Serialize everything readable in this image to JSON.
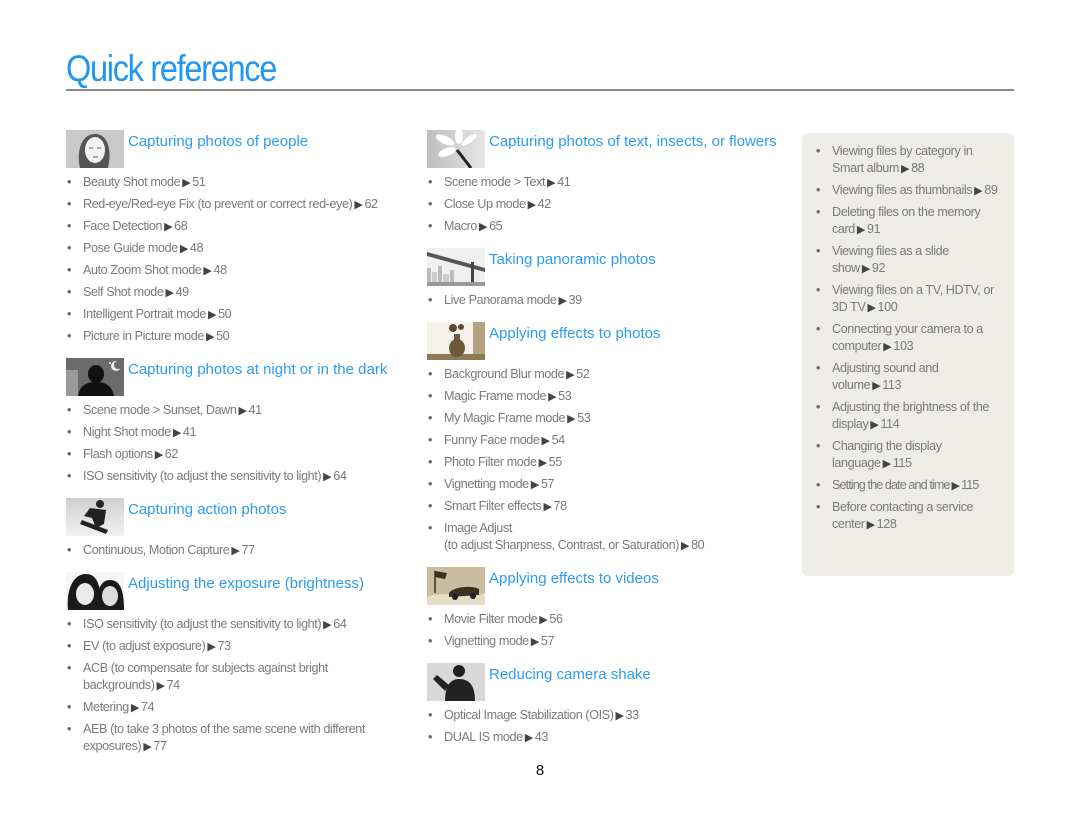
{
  "page": {
    "title": "Quick reference",
    "page_number": "8",
    "arrow_glyph": "▶"
  },
  "colors": {
    "heading": "#2196f3",
    "section_title": "#2b9cf0",
    "body_text": "#7a7a7a",
    "panel_bg": "#eeece6"
  },
  "column1": [
    {
      "title": "Capturing photos of people",
      "icon": "portrait-woman-icon",
      "items": [
        {
          "text": "Beauty Shot mode",
          "page": "51"
        },
        {
          "text": "Red-eye/Red-eye Fix (to prevent or correct red-eye)",
          "page": "62"
        },
        {
          "text": "Face Detection",
          "page": "68"
        },
        {
          "text": "Pose Guide mode",
          "page": "48"
        },
        {
          "text": "Auto Zoom Shot mode",
          "page": "48"
        },
        {
          "text": "Self Shot mode",
          "page": "49"
        },
        {
          "text": "Intelligent Portrait mode",
          "page": "50"
        },
        {
          "text": "Picture in Picture mode",
          "page": "50"
        }
      ]
    },
    {
      "title": "Capturing photos at night or in the dark",
      "icon": "night-silhouette-icon",
      "items": [
        {
          "text": "Scene mode > Sunset, Dawn",
          "page": "41"
        },
        {
          "text": "Night Shot mode",
          "page": "41"
        },
        {
          "text": "Flash options",
          "page": "62"
        },
        {
          "text": "ISO sensitivity (to adjust the sensitivity to light)",
          "page": "64"
        }
      ]
    },
    {
      "title": "Capturing action photos",
      "icon": "snowboarder-icon",
      "items": [
        {
          "text": "Continuous, Motion Capture",
          "page": "77"
        }
      ]
    },
    {
      "title": "Adjusting the exposure (brightness)",
      "icon": "couple-faces-icon",
      "items": [
        {
          "text": "ISO sensitivity (to adjust the sensitivity to light)",
          "page": "64"
        },
        {
          "text": "EV (to adjust exposure)",
          "page": "73"
        },
        {
          "text": "ACB (to compensate for subjects against bright backgrounds)",
          "page": "74"
        },
        {
          "text": "Metering",
          "page": "74"
        },
        {
          "text": "AEB (to take 3 photos of the same scene with different exposures)",
          "page": "77"
        }
      ]
    }
  ],
  "column2": [
    {
      "title": "Capturing  photos of text, insects, or flowers",
      "icon": "flower-macro-icon",
      "items": [
        {
          "text": "Scene mode > Text",
          "page": "41"
        },
        {
          "text": "Close Up mode",
          "page": "42"
        },
        {
          "text": "Macro",
          "page": "65"
        }
      ]
    },
    {
      "title": "Taking panoramic photos",
      "icon": "bridge-panorama-icon",
      "items": [
        {
          "text": "Live Panorama mode",
          "page": "39"
        }
      ]
    },
    {
      "title": "Applying effects to photos",
      "icon": "vase-still-life-icon",
      "items": [
        {
          "text": "Background Blur mode",
          "page": "52"
        },
        {
          "text": "Magic Frame mode",
          "page": "53"
        },
        {
          "text": "My Magic Frame mode",
          "page": "53"
        },
        {
          "text": "Funny Face mode",
          "page": "54"
        },
        {
          "text": "Photo Filter mode",
          "page": "55"
        },
        {
          "text": "Vignetting mode",
          "page": "57"
        },
        {
          "text": "Smart Filter effects",
          "page": "78"
        },
        {
          "text": "Image Adjust\n(to adjust Sharpness, Contrast, or Saturation)",
          "page": "80"
        }
      ]
    },
    {
      "title": "Applying effects to videos",
      "icon": "race-car-flag-icon",
      "items": [
        {
          "text": "Movie Filter mode",
          "page": "56"
        },
        {
          "text": "Vignetting mode",
          "page": "57"
        }
      ]
    },
    {
      "title": "Reducing camera shake",
      "icon": "waving-person-icon",
      "items": [
        {
          "text": "Optical Image Stabilization (OIS)",
          "page": "33"
        },
        {
          "text": "DUAL IS mode",
          "page": "43"
        }
      ]
    }
  ],
  "panel": {
    "items": [
      {
        "text": "Viewing files by category in Smart album",
        "page": "88"
      },
      {
        "text": "Viewing files as thumbnails",
        "page": "89"
      },
      {
        "text": "Deleting files on the memory card",
        "page": "91"
      },
      {
        "text": "Viewing files as a slide show",
        "page": "92"
      },
      {
        "text": "Viewing files on a TV, HDTV, or 3D TV",
        "page": "100"
      },
      {
        "text": "Connecting your camera to a computer",
        "page": "103"
      },
      {
        "text": "Adjusting sound and volume",
        "page": "113"
      },
      {
        "text": "Adjusting the brightness of the display",
        "page": "114"
      },
      {
        "text": "Changing the display language",
        "page": "115"
      },
      {
        "text": "Setting the date and time",
        "page": "115"
      },
      {
        "text": "Before contacting a service center",
        "page": "128"
      }
    ]
  }
}
